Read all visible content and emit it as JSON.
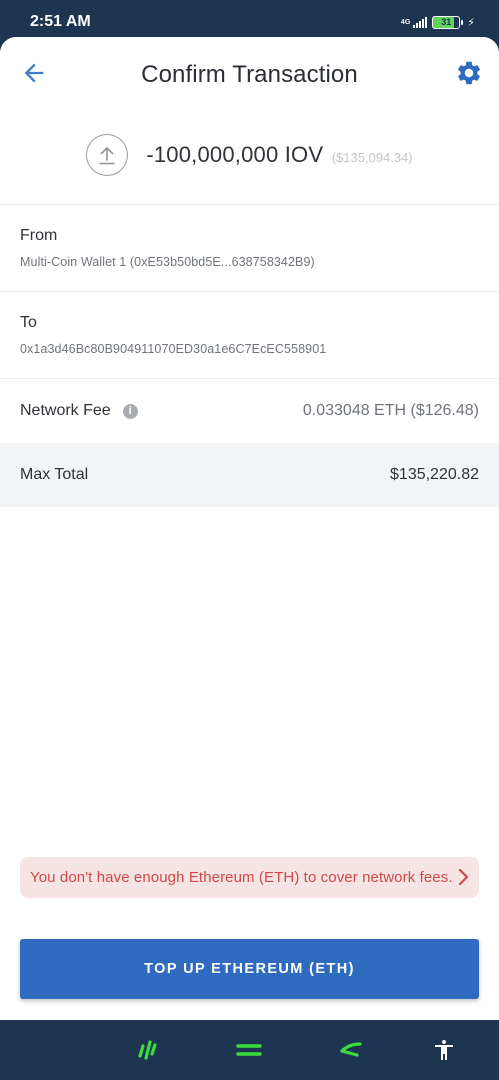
{
  "status_bar": {
    "time": "2:51 AM",
    "network": "4G",
    "battery": "31",
    "battery_level": 0.81
  },
  "header": {
    "title": "Confirm Transaction",
    "back_icon": "arrow-left-icon",
    "settings_icon": "gear-icon"
  },
  "amount": {
    "icon": "upload-arrow-icon",
    "value": "-100,000,000 IOV",
    "fiat": "($135,094.34)"
  },
  "from": {
    "label": "From",
    "value": "Multi-Coin Wallet 1 (0xE53b50bd5E...638758342B9)"
  },
  "to": {
    "label": "To",
    "value": "0x1a3d46Bc80B904911070ED30a1e6C7EcEC558901"
  },
  "network_fee": {
    "label": "Network Fee",
    "value": "0.033048 ETH ($126.48)"
  },
  "max_total": {
    "label": "Max Total",
    "value": "$135,220.82"
  },
  "warning": {
    "text": "You don't have enough Ethereum (ETH) to cover network fees.",
    "color": "#d04848"
  },
  "topup_button": {
    "label": "TOP UP ETHEREUM (ETH)",
    "color": "#2f6cbf"
  },
  "nav_bar": {
    "accent": "#3ddc3d",
    "items": [
      "recent-apps-icon",
      "home-icon",
      "back-icon",
      "accessibility-icon"
    ]
  }
}
